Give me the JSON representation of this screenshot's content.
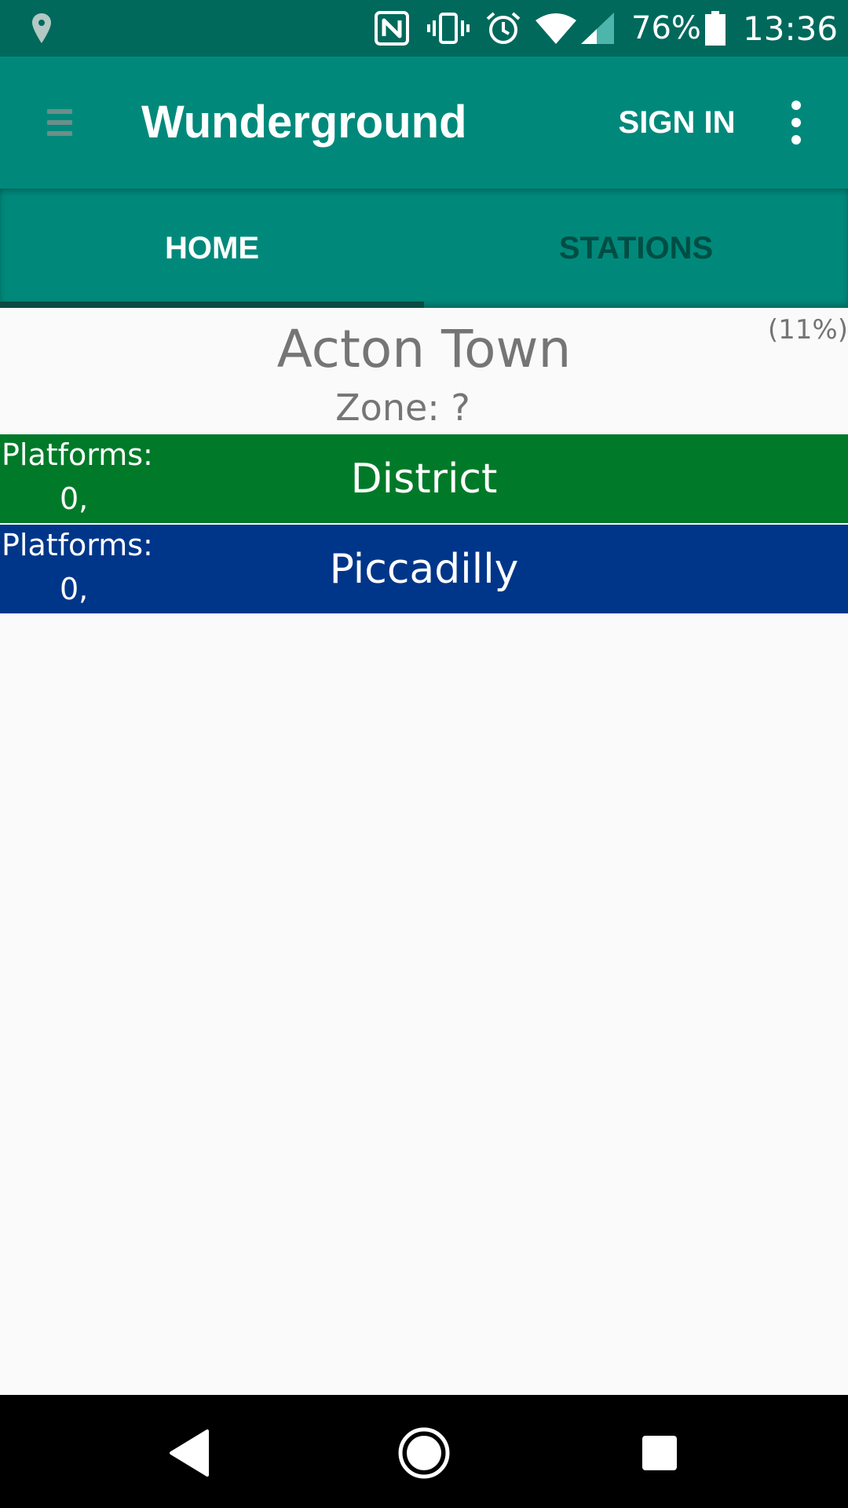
{
  "status_bar": {
    "battery_percent": "76%",
    "time": "13:36",
    "icons": [
      "location-icon",
      "nfc-icon",
      "vibrate-icon",
      "alarm-icon",
      "wifi-icon",
      "cell-signal-icon",
      "battery-icon"
    ]
  },
  "toolbar": {
    "title": "Wunderground",
    "sign_in_label": "SIGN IN",
    "menu_icon": "hamburger-menu-icon",
    "overflow_icon": "more-vert-icon"
  },
  "tabs": [
    {
      "label": "HOME",
      "selected": true
    },
    {
      "label": "STATIONS",
      "selected": false
    }
  ],
  "station": {
    "name": "Acton Town",
    "zone": "Zone: ?",
    "progress": "(11%)",
    "lines": [
      {
        "name": "District",
        "platforms_label": "Platforms:",
        "platforms_value": "0,",
        "color": "#007a28"
      },
      {
        "name": "Piccadilly",
        "platforms_label": "Platforms:",
        "platforms_value": "0,",
        "color": "#003689"
      }
    ]
  },
  "nav_bar": {
    "icons": [
      "back-icon",
      "home-icon",
      "recents-icon"
    ]
  },
  "colors": {
    "status_bar": "#00695c",
    "toolbar": "#00897b",
    "tab_indicator": "#0a4a43",
    "content_background": "#fafafa"
  }
}
